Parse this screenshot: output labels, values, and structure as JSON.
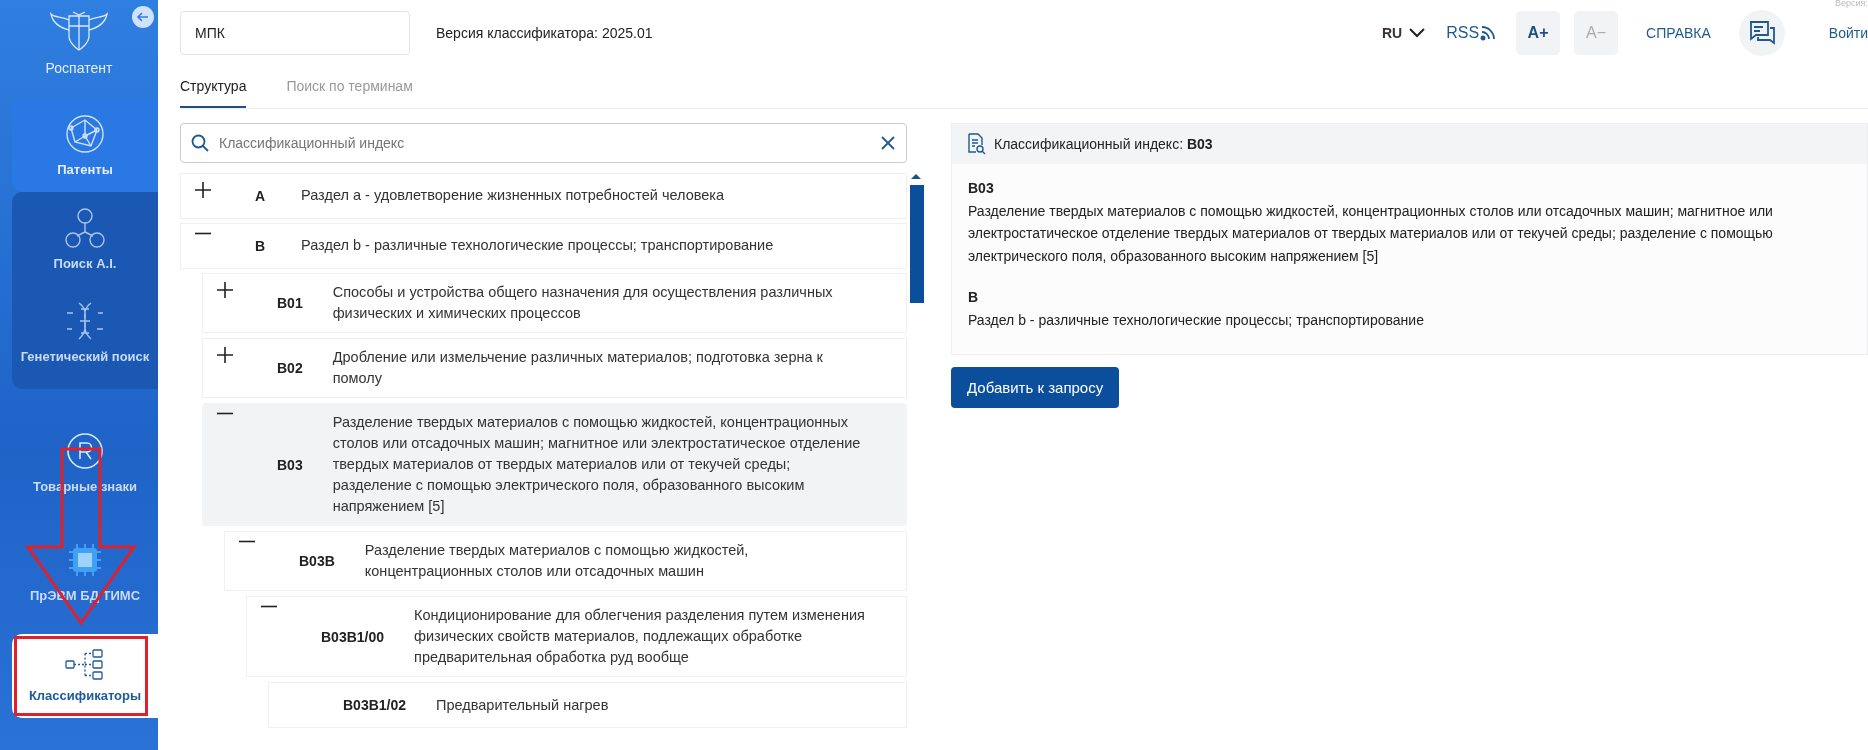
{
  "sidebar": {
    "logo_label": "Роспатент",
    "blocks": [
      {
        "kind": "tile",
        "items": [
          {
            "label": "Патенты",
            "selected": false
          }
        ]
      },
      {
        "kind": "group",
        "items": [
          {
            "label": "Поиск A.I.",
            "selected": false
          },
          {
            "label": "Генетический поиск",
            "selected": false
          }
        ]
      },
      {
        "kind": "plain",
        "items": [
          {
            "label": "Товарные знаки",
            "selected": false
          },
          {
            "label": "ПрЭВМ БД ТИМС",
            "selected": false
          },
          {
            "label": "Классификаторы",
            "selected": true
          }
        ]
      }
    ]
  },
  "classifier_field": {
    "value": "МПК"
  },
  "classifier_version": "Версия классификатора: 2025.01",
  "header": {
    "language": "RU",
    "rss": "RSS",
    "font_increase": "A+",
    "font_decrease": "A−",
    "font_decrease_disabled": true,
    "help": "СПРАВКА",
    "login": "Войти",
    "version_note": "Версия:"
  },
  "tabs": [
    {
      "label": "Структура",
      "selected": true
    },
    {
      "label": "Поиск по терминам",
      "selected": false
    }
  ],
  "search": {
    "placeholder": "Классификационный индекс"
  },
  "tree": [
    {
      "code": "A",
      "text": "Раздел а - удовлетворение жизненных потребностей человека",
      "expanded": false,
      "selected": false
    },
    {
      "code": "B",
      "text": "Раздел b - различные технологические процессы; транспортирование",
      "expanded": true,
      "selected": false,
      "children": [
        {
          "code": "B01",
          "text": "Способы и устройства общего назначения для осуществления различных физических и химических процессов",
          "expanded": false,
          "selected": false
        },
        {
          "code": "B02",
          "text": "Дробление или измельчение различных материалов; подготовка зерна к помолу",
          "expanded": false,
          "selected": false
        },
        {
          "code": "B03",
          "text": "Разделение твердых материалов с помощью жидкостей, концентрационных столов или отсадочных машин; магнитное или электростатическое отделение твердых материалов от твердых материалов или от текучей среды; разделение с помощью электрического поля, образованного высоким напряжением [5]",
          "expanded": true,
          "selected": true,
          "children": [
            {
              "code": "B03B",
              "text": "Разделение твердых материалов с помощью жидкостей, концентрационных столов или отсадочных машин",
              "expanded": true,
              "selected": false,
              "children": [
                {
                  "code": "B03B1/00",
                  "text": "Кондиционирование для облегчения разделения путем изменения физических свойств материалов, подлежащих обработке предварительная обработка руд вообще",
                  "expanded": true,
                  "selected": false,
                  "children": [
                    {
                      "code": "B03B1/02",
                      "text": "Предварительный нагрев",
                      "selected": false
                    }
                  ]
                }
              ]
            }
          ]
        }
      ]
    }
  ],
  "details": {
    "header_label": "Классификационный индекс: **B03**",
    "entries": [
      {
        "code": "B03",
        "text": "Разделение твердых материалов с помощью жидкостей, концентрационных столов или отсадочных машин; магнитное или электростатическое отделение твердых материалов от твердых материалов или от текучей среды; разделение с помощью электрического поля, образованного высоким напряжением [5]"
      },
      {
        "code": "B",
        "text": "Раздел b - различные технологические процессы; транспортирование"
      }
    ],
    "button": "Добавить к запросу"
  }
}
